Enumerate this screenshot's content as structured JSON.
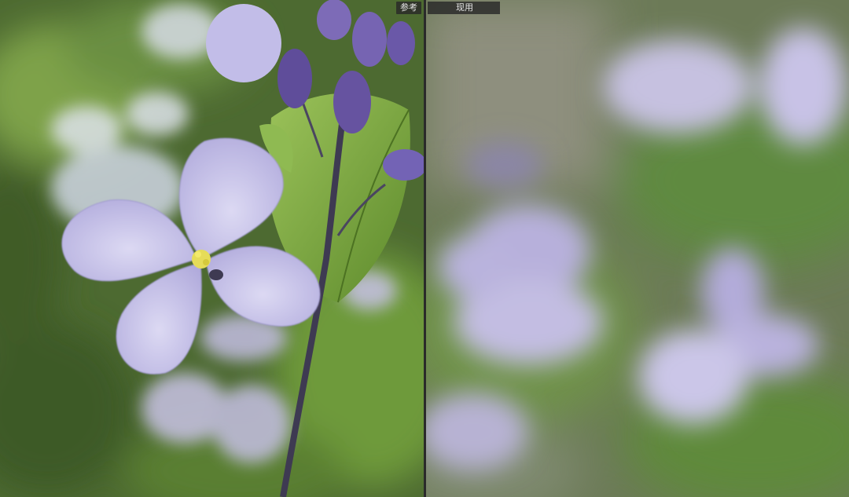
{
  "compare": {
    "reference_label": "参考",
    "current_label": "现用"
  },
  "images": {
    "reference": {
      "subject": "purple-rocket-flower-sharp"
    },
    "current": {
      "subject": "purple-flowers-out-of-focus"
    }
  },
  "colors": {
    "background_green": "#4f6b33",
    "leaf_green": "#7fa744",
    "petal_lavender": "#c3bfe6",
    "bud_purple": "#6d5aa8",
    "stamen_yellow": "#e3d548",
    "label_bg": "#2a2a2a"
  }
}
